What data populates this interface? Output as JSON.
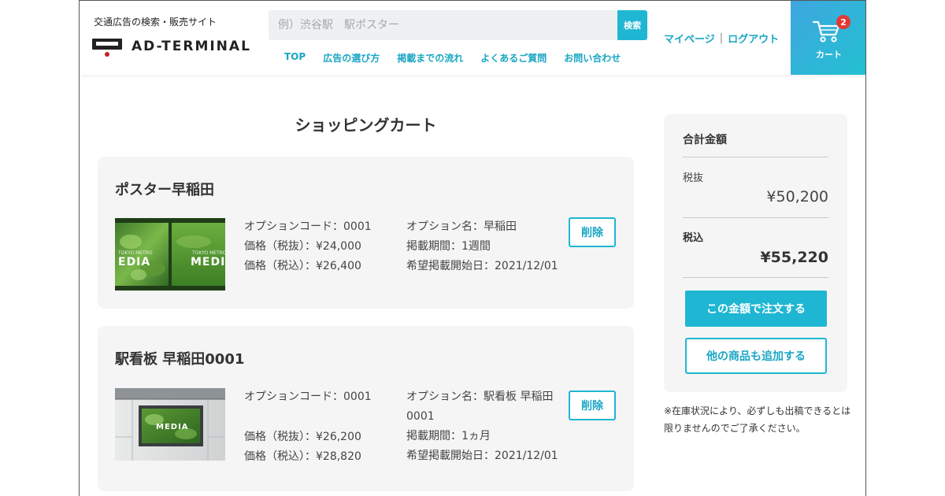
{
  "header": {
    "tagline": "交通広告の検索・販売サイト",
    "logo_text": "AD-TERMINAL",
    "search_placeholder": "例）渋谷駅　駅ポスター",
    "search_button": "検索",
    "nav": [
      "TOP",
      "広告の選び方",
      "掲載までの流れ",
      "よくあるご質問",
      "お問い合わせ"
    ],
    "mypage": "マイページ",
    "separator": "|",
    "logout": "ログアウト",
    "cart_label": "カート",
    "cart_count": "2"
  },
  "page_title": "ショッピングカート",
  "items": [
    {
      "title": "ポスター早稲田",
      "option_code": "オプションコード：0001",
      "price_ex": "価格（税抜）：¥24,000",
      "price_in": "価格（税込）：¥26,400",
      "option_name": "オプション名：早稲田",
      "period": "掲載期間：1週間",
      "start_date": "希望掲載開始日：2021/12/01",
      "delete": "削除",
      "thumb_text": "MEDIA",
      "thumb_sub": "TOKYO METRO"
    },
    {
      "title": "駅看板 早稲田0001",
      "option_code": "オプションコード：0001",
      "price_ex": "価格（税抜）：¥26,200",
      "price_in": "価格（税込）：¥28,820",
      "option_name_line1": "オプション名：駅看板 早稲田",
      "option_name_line2": "0001",
      "period": "掲載期間：1ヵ月",
      "start_date": "希望掲載開始日：2021/12/01",
      "delete": "削除",
      "thumb_text": "MEDIA"
    }
  ],
  "summary": {
    "heading": "合計金額",
    "ex_label": "税抜",
    "ex_value": "¥50,200",
    "in_label": "税込",
    "in_value": "¥55,220",
    "order_button": "この金額で注文する",
    "add_button": "他の商品も追加する"
  },
  "note": "※在庫状況により、必ずしも出稿できるとは限りませんのでご了承ください。",
  "colors": {
    "accent": "#1fb6d3",
    "accent_text": "#1aa6c4",
    "panel": "#f5f5f5",
    "badge": "#e53935"
  },
  "icons": [
    "cart-icon"
  ]
}
